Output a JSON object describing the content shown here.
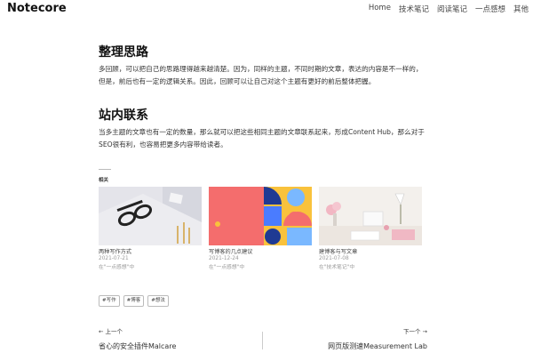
{
  "header": {
    "logo": "Notecore",
    "nav": [
      "Home",
      "技术笔记",
      "阅读笔记",
      "一点感想",
      "其他"
    ]
  },
  "sections": [
    {
      "heading": "整理思路",
      "paragraph": "多回顾，可以把自己的思路理得越来越清楚。因为，同样的主题，不同时期的文章，表达的内容是不一样的，但是，前后也有一定的逻辑关系。因此，回顾可以让自己对这个主题有更好的前后整体把握。"
    },
    {
      "heading": "站内联系",
      "paragraph": "当多主题的文章也有一定的数量，那么就可以把这些相同主题的文章联系起来，形成Content Hub，那么对于SEO很有利，也容易把更多内容带给读者。"
    }
  ],
  "related": {
    "label": "相关",
    "cards": [
      {
        "title": "两种写作方式",
        "date": "2021-07-21",
        "category": "在\"一点感想\"中"
      },
      {
        "title": "写博客的几点建议",
        "date": "2021-12-24",
        "category": "在\"一点感想\"中"
      },
      {
        "title": "建博客与写文章",
        "date": "2021-07-08",
        "category": "在\"技术笔记\"中"
      }
    ]
  },
  "tags": [
    "#写作",
    "#博客",
    "#想法"
  ],
  "pager": {
    "prev_label": "← 上一个",
    "prev_title": "省心的安全插件Malcare",
    "next_label": "下一个 →",
    "next_title": "网页版测速Measurement Lab"
  }
}
